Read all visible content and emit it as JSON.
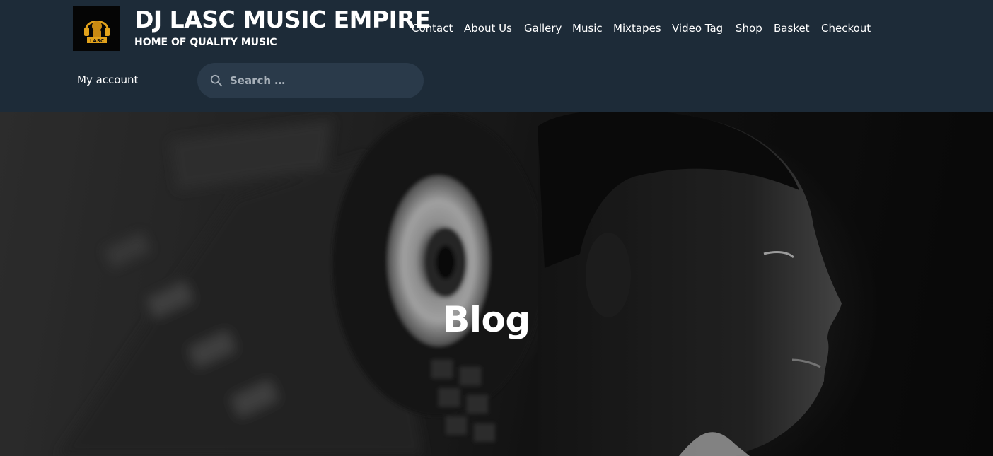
{
  "site": {
    "logo_icon": "dj-headphones-logo",
    "logo_text": "LASC",
    "title": "DJ LASC MUSIC EMPIRE",
    "tagline": "HOME OF QUALITY MUSIC"
  },
  "nav": {
    "items": [
      {
        "label": "Contact"
      },
      {
        "label": "About Us"
      },
      {
        "label": "Gallery"
      },
      {
        "label": "Music"
      },
      {
        "label": "Mixtapes"
      },
      {
        "label": "Video Tag"
      },
      {
        "label": "Shop"
      },
      {
        "label": "Basket"
      },
      {
        "label": "Checkout"
      }
    ]
  },
  "account": {
    "label": "My account"
  },
  "search": {
    "icon": "search-icon",
    "placeholder": "Search …",
    "value": ""
  },
  "hero": {
    "title": "Blog",
    "image": "dj-at-turntable-photo"
  },
  "colors": {
    "header_bg": "#1d2b38",
    "search_bg": "#2a3a4a",
    "text": "#ffffff",
    "logo_gold": "#e2a21b"
  }
}
